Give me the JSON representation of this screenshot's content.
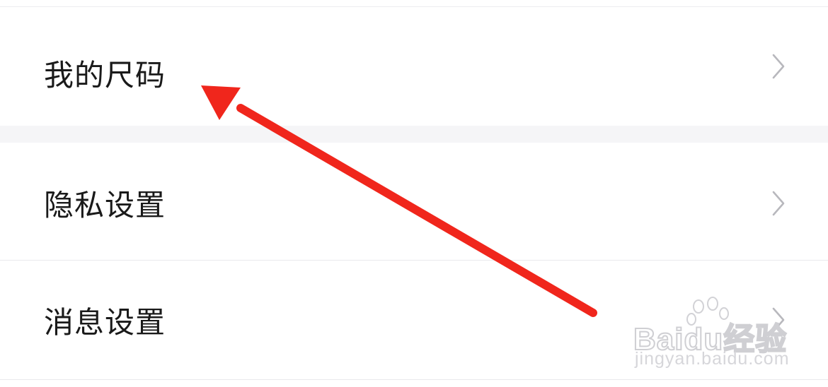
{
  "settings": {
    "items": [
      {
        "label": "我的尺码"
      },
      {
        "label": "隐私设置"
      },
      {
        "label": "消息设置"
      }
    ]
  },
  "icons": {
    "chevron": "chevron-right-icon",
    "annotation": "red-arrow"
  },
  "colors": {
    "background": "#ffffff",
    "section_gap": "#f5f5f7",
    "text": "#1a1a1a",
    "chevron": "#b8b8bd",
    "annotation_arrow": "#f0261c"
  },
  "watermark": {
    "main": "Baidu经验",
    "sub": "jingyan.baidu.com"
  }
}
